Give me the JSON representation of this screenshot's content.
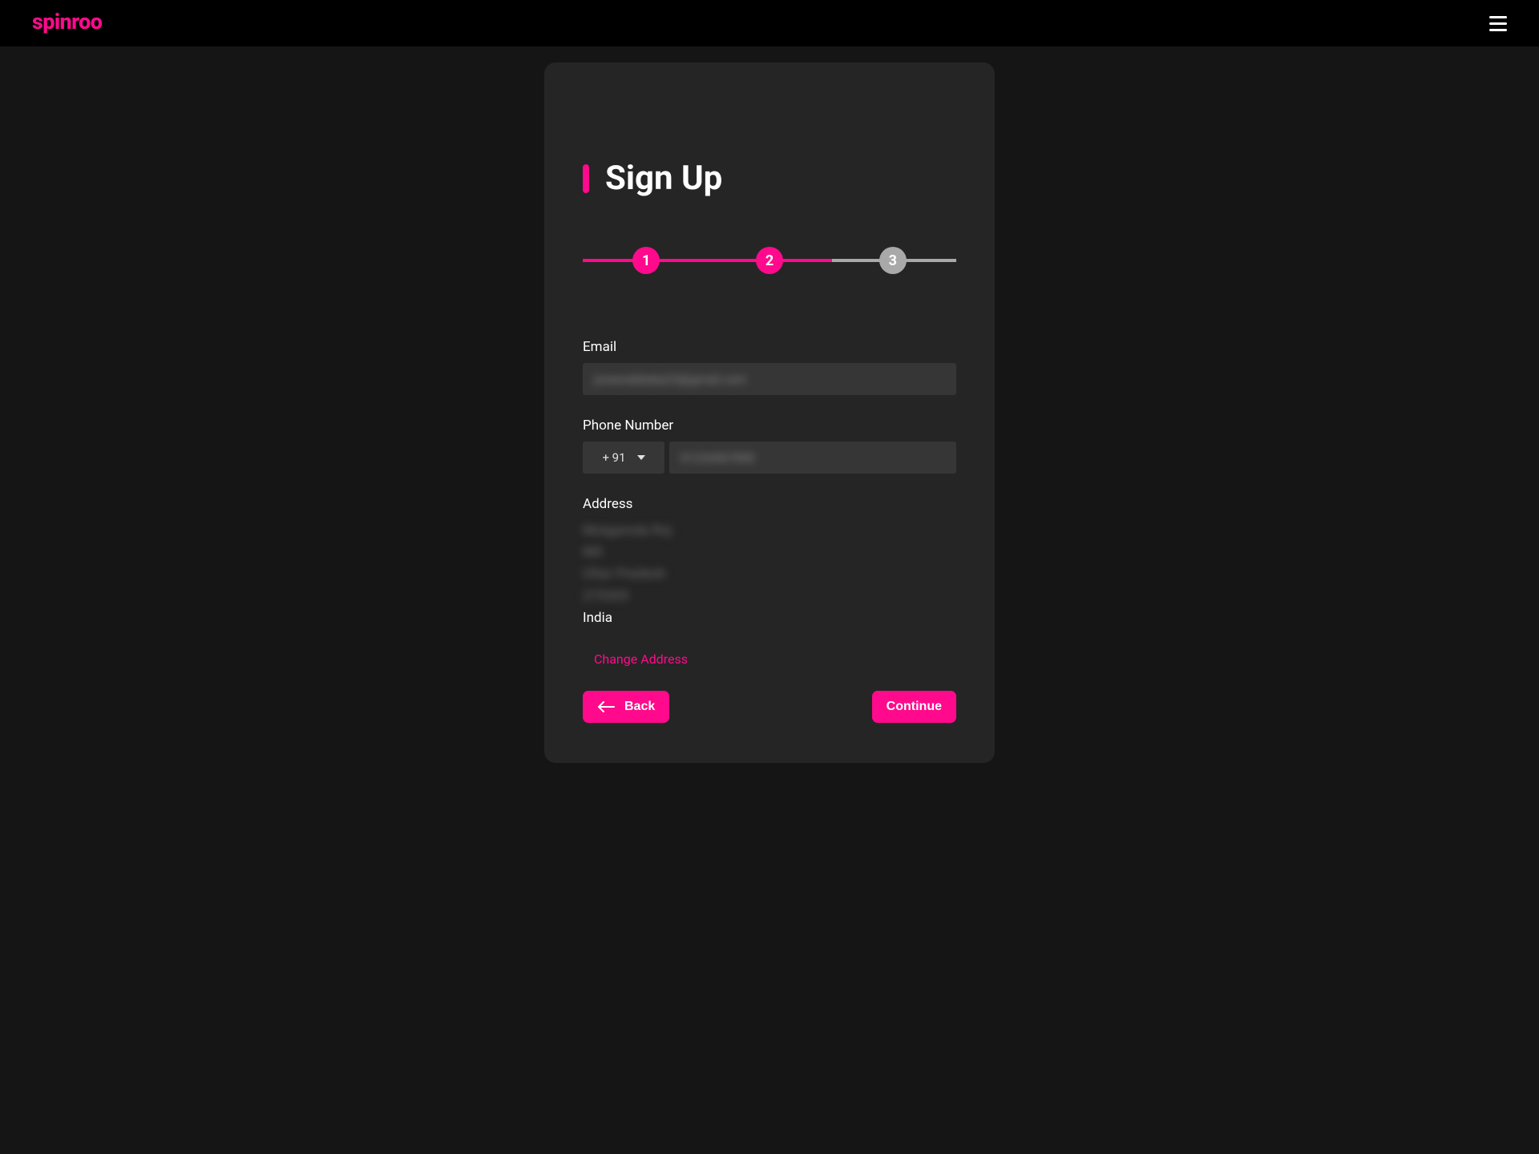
{
  "brand": {
    "logo_text": "spinroo"
  },
  "page": {
    "title": "Sign Up"
  },
  "stepper": {
    "steps": [
      {
        "label": "1",
        "status": "done"
      },
      {
        "label": "2",
        "status": "current"
      },
      {
        "label": "3",
        "status": "todo"
      }
    ]
  },
  "form": {
    "email": {
      "label": "Email",
      "value": "jonesrebbeka23@gmail.com"
    },
    "phone": {
      "label": "Phone Number",
      "dial_code": "+ 91",
      "value": "01234567890"
    },
    "address": {
      "label": "Address",
      "lines_blurred": [
        "Mutgamda Roj",
        "MS",
        "Uttar Pradesh",
        "275305"
      ],
      "visible_line": "India"
    },
    "change_address_label": "Change Address"
  },
  "buttons": {
    "back": "Back",
    "continue": "Continue"
  }
}
